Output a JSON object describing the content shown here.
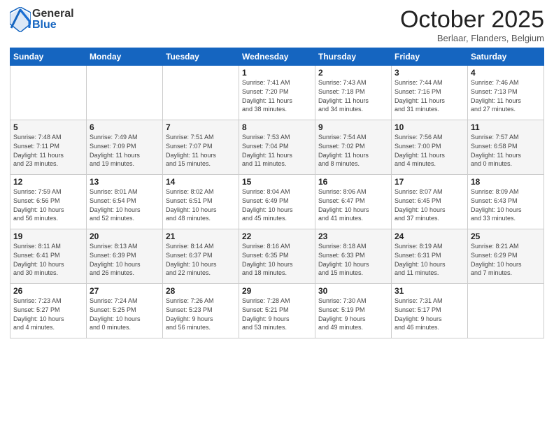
{
  "header": {
    "logo_general": "General",
    "logo_blue": "Blue",
    "month_title": "October 2025",
    "subtitle": "Berlaar, Flanders, Belgium"
  },
  "calendar": {
    "days_of_week": [
      "Sunday",
      "Monday",
      "Tuesday",
      "Wednesday",
      "Thursday",
      "Friday",
      "Saturday"
    ],
    "weeks": [
      [
        {
          "day": "",
          "info": ""
        },
        {
          "day": "",
          "info": ""
        },
        {
          "day": "",
          "info": ""
        },
        {
          "day": "1",
          "info": "Sunrise: 7:41 AM\nSunset: 7:20 PM\nDaylight: 11 hours\nand 38 minutes."
        },
        {
          "day": "2",
          "info": "Sunrise: 7:43 AM\nSunset: 7:18 PM\nDaylight: 11 hours\nand 34 minutes."
        },
        {
          "day": "3",
          "info": "Sunrise: 7:44 AM\nSunset: 7:16 PM\nDaylight: 11 hours\nand 31 minutes."
        },
        {
          "day": "4",
          "info": "Sunrise: 7:46 AM\nSunset: 7:13 PM\nDaylight: 11 hours\nand 27 minutes."
        }
      ],
      [
        {
          "day": "5",
          "info": "Sunrise: 7:48 AM\nSunset: 7:11 PM\nDaylight: 11 hours\nand 23 minutes."
        },
        {
          "day": "6",
          "info": "Sunrise: 7:49 AM\nSunset: 7:09 PM\nDaylight: 11 hours\nand 19 minutes."
        },
        {
          "day": "7",
          "info": "Sunrise: 7:51 AM\nSunset: 7:07 PM\nDaylight: 11 hours\nand 15 minutes."
        },
        {
          "day": "8",
          "info": "Sunrise: 7:53 AM\nSunset: 7:04 PM\nDaylight: 11 hours\nand 11 minutes."
        },
        {
          "day": "9",
          "info": "Sunrise: 7:54 AM\nSunset: 7:02 PM\nDaylight: 11 hours\nand 8 minutes."
        },
        {
          "day": "10",
          "info": "Sunrise: 7:56 AM\nSunset: 7:00 PM\nDaylight: 11 hours\nand 4 minutes."
        },
        {
          "day": "11",
          "info": "Sunrise: 7:57 AM\nSunset: 6:58 PM\nDaylight: 11 hours\nand 0 minutes."
        }
      ],
      [
        {
          "day": "12",
          "info": "Sunrise: 7:59 AM\nSunset: 6:56 PM\nDaylight: 10 hours\nand 56 minutes."
        },
        {
          "day": "13",
          "info": "Sunrise: 8:01 AM\nSunset: 6:54 PM\nDaylight: 10 hours\nand 52 minutes."
        },
        {
          "day": "14",
          "info": "Sunrise: 8:02 AM\nSunset: 6:51 PM\nDaylight: 10 hours\nand 48 minutes."
        },
        {
          "day": "15",
          "info": "Sunrise: 8:04 AM\nSunset: 6:49 PM\nDaylight: 10 hours\nand 45 minutes."
        },
        {
          "day": "16",
          "info": "Sunrise: 8:06 AM\nSunset: 6:47 PM\nDaylight: 10 hours\nand 41 minutes."
        },
        {
          "day": "17",
          "info": "Sunrise: 8:07 AM\nSunset: 6:45 PM\nDaylight: 10 hours\nand 37 minutes."
        },
        {
          "day": "18",
          "info": "Sunrise: 8:09 AM\nSunset: 6:43 PM\nDaylight: 10 hours\nand 33 minutes."
        }
      ],
      [
        {
          "day": "19",
          "info": "Sunrise: 8:11 AM\nSunset: 6:41 PM\nDaylight: 10 hours\nand 30 minutes."
        },
        {
          "day": "20",
          "info": "Sunrise: 8:13 AM\nSunset: 6:39 PM\nDaylight: 10 hours\nand 26 minutes."
        },
        {
          "day": "21",
          "info": "Sunrise: 8:14 AM\nSunset: 6:37 PM\nDaylight: 10 hours\nand 22 minutes."
        },
        {
          "day": "22",
          "info": "Sunrise: 8:16 AM\nSunset: 6:35 PM\nDaylight: 10 hours\nand 18 minutes."
        },
        {
          "day": "23",
          "info": "Sunrise: 8:18 AM\nSunset: 6:33 PM\nDaylight: 10 hours\nand 15 minutes."
        },
        {
          "day": "24",
          "info": "Sunrise: 8:19 AM\nSunset: 6:31 PM\nDaylight: 10 hours\nand 11 minutes."
        },
        {
          "day": "25",
          "info": "Sunrise: 8:21 AM\nSunset: 6:29 PM\nDaylight: 10 hours\nand 7 minutes."
        }
      ],
      [
        {
          "day": "26",
          "info": "Sunrise: 7:23 AM\nSunset: 5:27 PM\nDaylight: 10 hours\nand 4 minutes."
        },
        {
          "day": "27",
          "info": "Sunrise: 7:24 AM\nSunset: 5:25 PM\nDaylight: 10 hours\nand 0 minutes."
        },
        {
          "day": "28",
          "info": "Sunrise: 7:26 AM\nSunset: 5:23 PM\nDaylight: 9 hours\nand 56 minutes."
        },
        {
          "day": "29",
          "info": "Sunrise: 7:28 AM\nSunset: 5:21 PM\nDaylight: 9 hours\nand 53 minutes."
        },
        {
          "day": "30",
          "info": "Sunrise: 7:30 AM\nSunset: 5:19 PM\nDaylight: 9 hours\nand 49 minutes."
        },
        {
          "day": "31",
          "info": "Sunrise: 7:31 AM\nSunset: 5:17 PM\nDaylight: 9 hours\nand 46 minutes."
        },
        {
          "day": "",
          "info": ""
        }
      ]
    ]
  }
}
